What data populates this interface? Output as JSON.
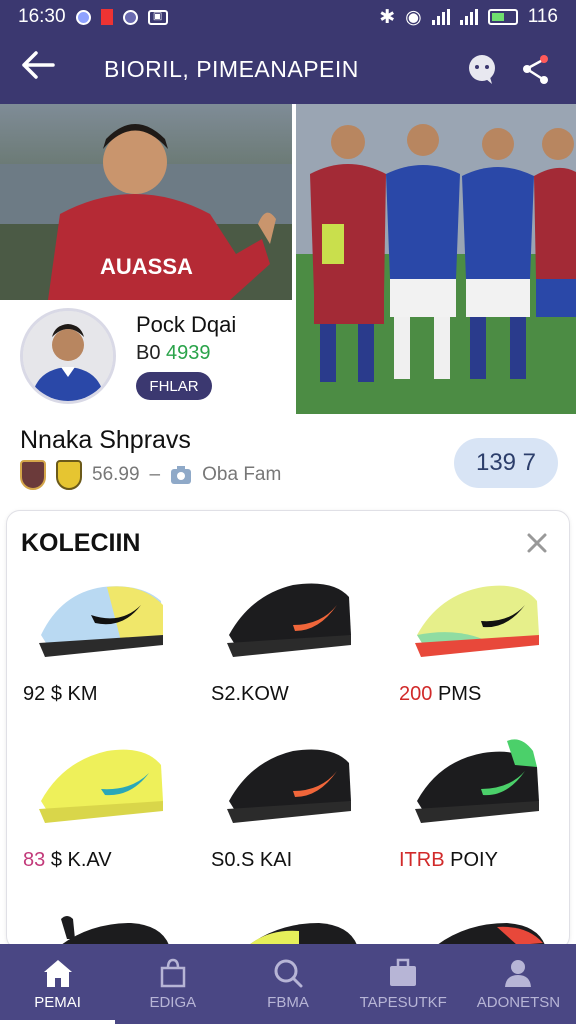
{
  "status": {
    "time": "16:30",
    "battery": "116"
  },
  "appbar": {
    "title": "BIORIL, PIMEANAPEIN"
  },
  "player": {
    "name": "Pock Dqai",
    "stat_prefix": "B0",
    "stat_value": "4939",
    "button": "FHLAR"
  },
  "hero": {
    "jersey_text": "AUASSA"
  },
  "info": {
    "name": "Nnaka Shpravs",
    "rating": "56.99",
    "separator": "–",
    "team": "Oba Fam",
    "pill": "139 7"
  },
  "collection": {
    "title": "KOLECIIN",
    "items": [
      {
        "price_a": "92",
        "price_b": "$ KM"
      },
      {
        "price_a": "S2.KOW",
        "price_b": ""
      },
      {
        "price_a": "200",
        "price_b": "PMS"
      },
      {
        "price_a": "83",
        "price_b": "$ K.AV"
      },
      {
        "price_a": "S0.S KAI",
        "price_b": ""
      },
      {
        "price_a": "ITRB",
        "price_b": "POIY"
      }
    ]
  },
  "nav": {
    "items": [
      {
        "label": "PEMAI"
      },
      {
        "label": "EDIGA"
      },
      {
        "label": "FBMA"
      },
      {
        "label": "TAPESUTKF"
      },
      {
        "label": "ADONETSN"
      }
    ]
  }
}
